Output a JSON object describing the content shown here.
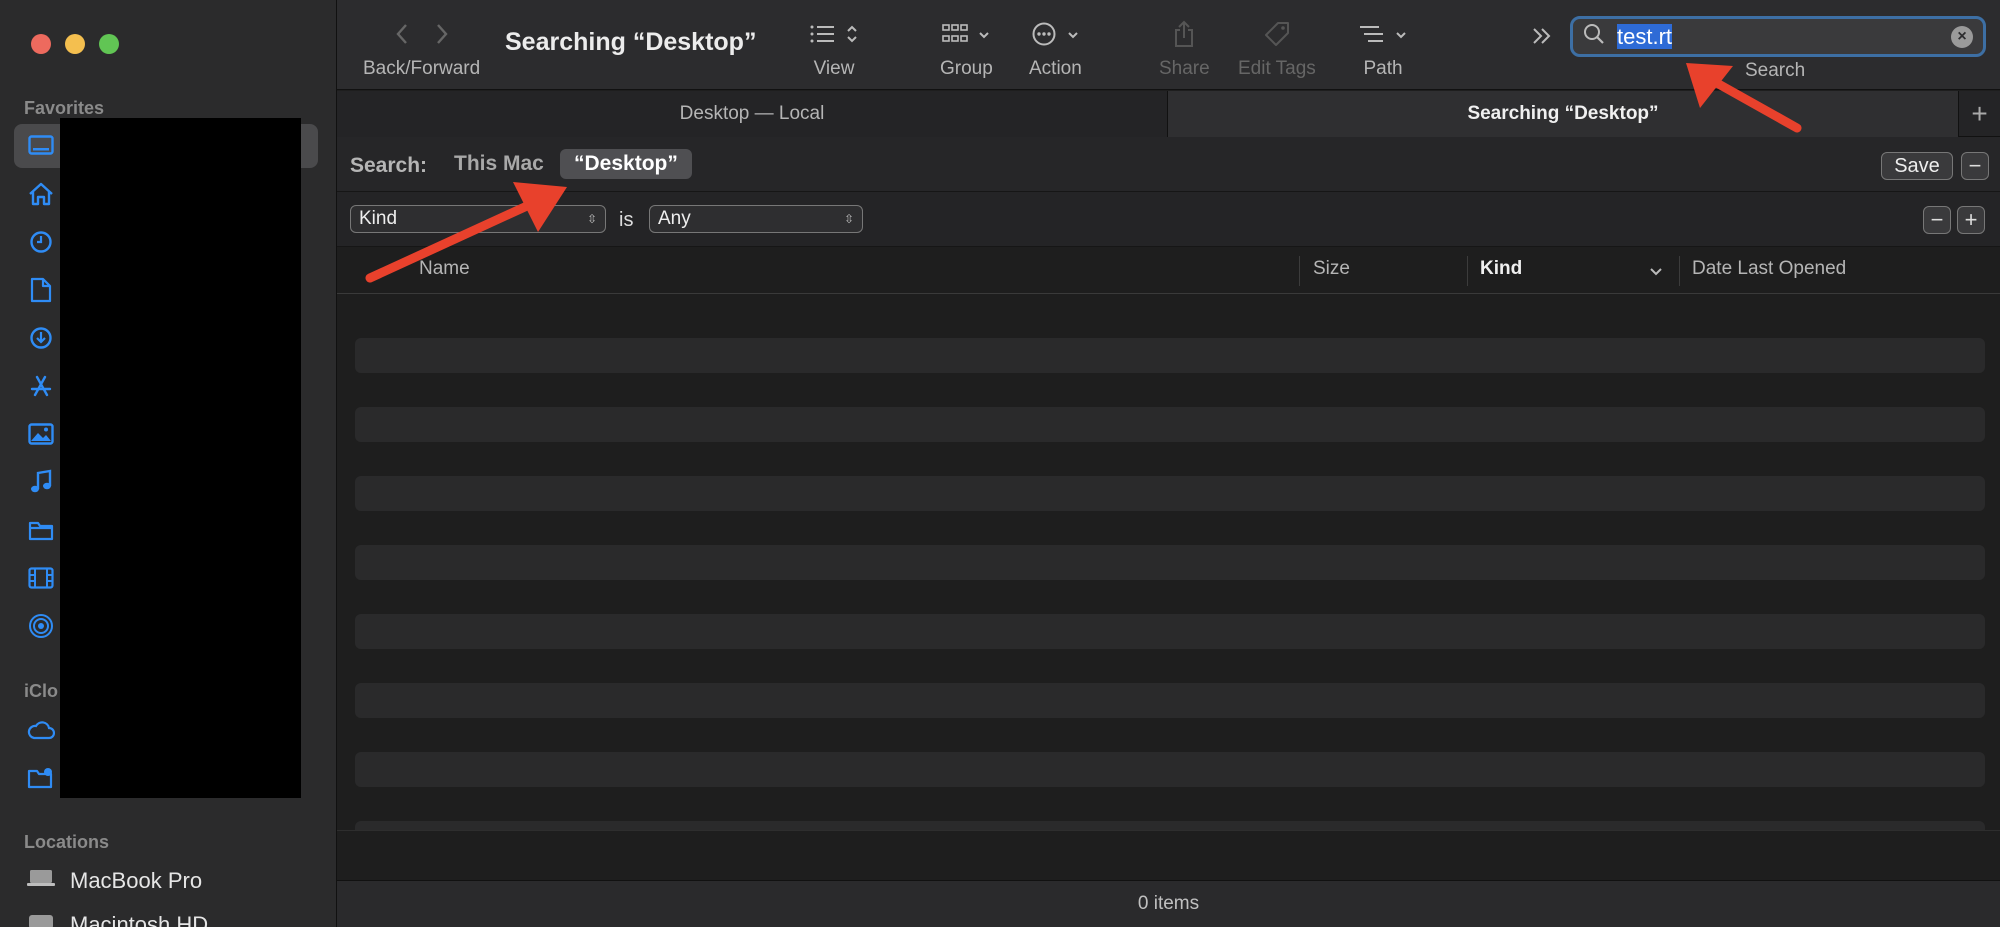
{
  "sidebar": {
    "favorites_label": "Favorites",
    "icloud_label": "iClo",
    "locations_label": "Locations",
    "favorites_icons": [
      "desktop-icon",
      "home-icon",
      "recents-icon",
      "documents-icon",
      "downloads-icon",
      "applications-icon",
      "pictures-icon",
      "music-icon",
      "folder-icon",
      "movies-icon",
      "airdrop-icon"
    ],
    "icloud_icons": [
      "icloud-drive-icon",
      "shared-folder-icon"
    ],
    "locations": [
      {
        "label": "MacBook Pro",
        "icon": "laptop-icon"
      },
      {
        "label": "Macintosh HD",
        "icon": "disk-icon"
      }
    ],
    "accent": "#2f8cf5"
  },
  "toolbar": {
    "title": "Searching “Desktop”",
    "back_forward_label": "Back/Forward",
    "view_label": "View",
    "group_label": "Group",
    "action_label": "Action",
    "share_label": "Share",
    "edit_tags_label": "Edit Tags",
    "path_label": "Path",
    "search_label": "Search",
    "search_value": "test.rt",
    "more_glyph": "»"
  },
  "tabs": [
    {
      "label": "Desktop — Local",
      "active": false
    },
    {
      "label": "Searching “Desktop”",
      "active": true
    }
  ],
  "tab_add": "+",
  "scope": {
    "label": "Search:",
    "this_mac": "This Mac",
    "desktop": "“Desktop”",
    "save": "Save",
    "remove": "−"
  },
  "criteria": {
    "attribute": "Kind",
    "operator": "is",
    "value": "Any",
    "remove": "−",
    "add": "+"
  },
  "columns": {
    "name": "Name",
    "size": "Size",
    "kind": "Kind",
    "date_last_opened": "Date Last Opened"
  },
  "status": {
    "items": "0 items"
  },
  "annotation_color": "#e8412c"
}
